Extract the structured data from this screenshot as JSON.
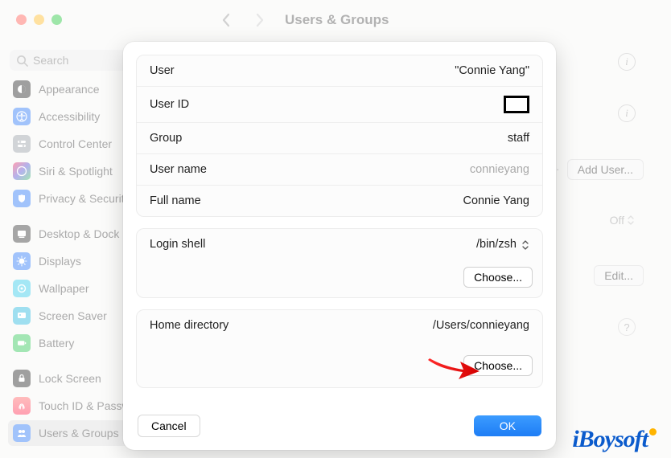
{
  "header": {
    "title": "Users & Groups"
  },
  "search": {
    "placeholder": "Search"
  },
  "sidebar": {
    "items": [
      {
        "label": "Appearance"
      },
      {
        "label": "Accessibility"
      },
      {
        "label": "Control Center"
      },
      {
        "label": "Siri & Spotlight"
      },
      {
        "label": "Privacy & Security"
      },
      {
        "label": "Desktop & Dock"
      },
      {
        "label": "Displays"
      },
      {
        "label": "Wallpaper"
      },
      {
        "label": "Screen Saver"
      },
      {
        "label": "Battery"
      },
      {
        "label": "Lock Screen"
      },
      {
        "label": "Touch ID & Password"
      },
      {
        "label": "Users & Groups"
      }
    ]
  },
  "right": {
    "add_user": "Add User...",
    "off_label": "Off",
    "edit": "Edit...",
    "group_dots": "..."
  },
  "dialog": {
    "rows": {
      "user": {
        "label": "User",
        "value": "\"Connie Yang\""
      },
      "user_id": {
        "label": "User ID"
      },
      "group": {
        "label": "Group",
        "value": "staff"
      },
      "user_name": {
        "label": "User name",
        "value": "connieyang"
      },
      "full_name": {
        "label": "Full name",
        "value": "Connie Yang"
      },
      "login_shell": {
        "label": "Login shell",
        "value": "/bin/zsh",
        "choose": "Choose..."
      },
      "home_dir": {
        "label": "Home directory",
        "value": "/Users/connieyang",
        "choose": "Choose..."
      }
    },
    "actions": {
      "cancel": "Cancel",
      "ok": "OK"
    }
  },
  "watermark": "iBoysoft"
}
